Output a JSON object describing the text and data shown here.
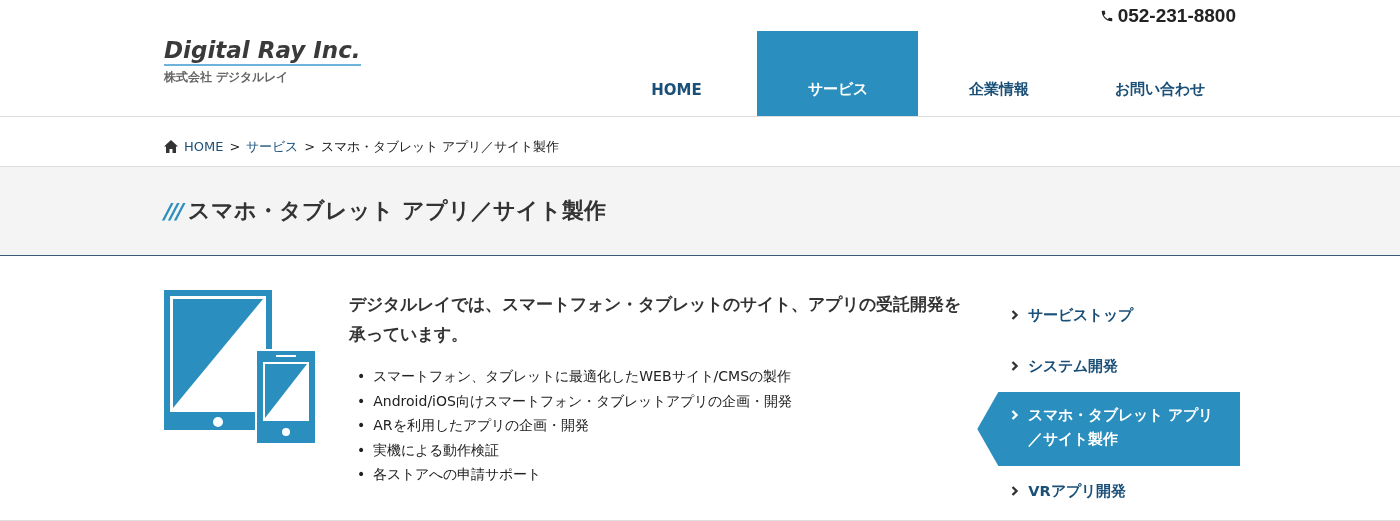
{
  "header": {
    "logo": {
      "name": "Digital Ray Inc.",
      "subtitle": "株式会社 デジタルレイ"
    },
    "phone": "052-231-8800",
    "nav": [
      {
        "label": "HOME",
        "selected": false
      },
      {
        "label": "サービス",
        "selected": true
      },
      {
        "label": "企業情報",
        "selected": false
      },
      {
        "label": "お問い合わせ",
        "selected": false
      }
    ]
  },
  "breadcrumb": [
    {
      "label": "HOME",
      "link": true
    },
    {
      "label": "サービス",
      "link": true
    },
    {
      "label": "スマホ・タブレット アプリ／サイト製作",
      "link": false
    }
  ],
  "breadcrumb_separator": ">",
  "page_title": {
    "mark": "///",
    "text": "スマホ・タブレット アプリ／サイト製作"
  },
  "content": {
    "bullet_marker": "•",
    "lead": "デジタルレイでは、スマートフォン・タブレットのサイト、アプリの受託開発を承っています。",
    "bullets": [
      "スマートフォン、タブレットに最適化したWEBサイト/CMSの製作",
      "Android/iOS向けスマートフォン・タブレットアプリの企画・開発",
      "ARを利用したアプリの企画・開発",
      "実機による動作検証",
      "各ストアへの申請サポート"
    ]
  },
  "side_nav": [
    {
      "label": "サービストップ",
      "selected": false
    },
    {
      "label": "システム開発",
      "selected": false
    },
    {
      "label": "スマホ・タブレット アプリ／サイト製作",
      "selected": true
    },
    {
      "label": "VRアプリ開発",
      "selected": false
    }
  ]
}
